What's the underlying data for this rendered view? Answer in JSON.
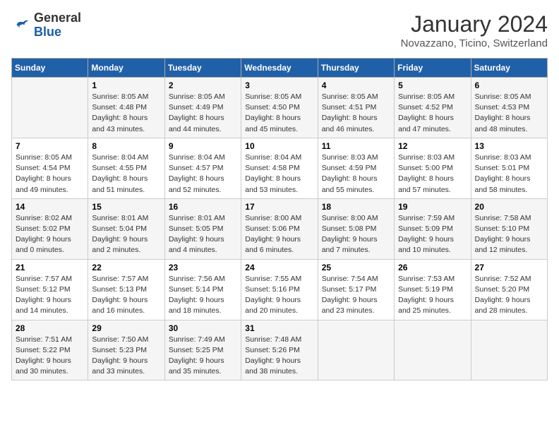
{
  "logo": {
    "general": "General",
    "blue": "Blue"
  },
  "header": {
    "month": "January 2024",
    "location": "Novazzano, Ticino, Switzerland"
  },
  "days_of_week": [
    "Sunday",
    "Monday",
    "Tuesday",
    "Wednesday",
    "Thursday",
    "Friday",
    "Saturday"
  ],
  "weeks": [
    [
      {
        "day": "",
        "info": ""
      },
      {
        "day": "1",
        "info": "Sunrise: 8:05 AM\nSunset: 4:48 PM\nDaylight: 8 hours\nand 43 minutes."
      },
      {
        "day": "2",
        "info": "Sunrise: 8:05 AM\nSunset: 4:49 PM\nDaylight: 8 hours\nand 44 minutes."
      },
      {
        "day": "3",
        "info": "Sunrise: 8:05 AM\nSunset: 4:50 PM\nDaylight: 8 hours\nand 45 minutes."
      },
      {
        "day": "4",
        "info": "Sunrise: 8:05 AM\nSunset: 4:51 PM\nDaylight: 8 hours\nand 46 minutes."
      },
      {
        "day": "5",
        "info": "Sunrise: 8:05 AM\nSunset: 4:52 PM\nDaylight: 8 hours\nand 47 minutes."
      },
      {
        "day": "6",
        "info": "Sunrise: 8:05 AM\nSunset: 4:53 PM\nDaylight: 8 hours\nand 48 minutes."
      }
    ],
    [
      {
        "day": "7",
        "info": "Sunrise: 8:05 AM\nSunset: 4:54 PM\nDaylight: 8 hours\nand 49 minutes."
      },
      {
        "day": "8",
        "info": "Sunrise: 8:04 AM\nSunset: 4:55 PM\nDaylight: 8 hours\nand 51 minutes."
      },
      {
        "day": "9",
        "info": "Sunrise: 8:04 AM\nSunset: 4:57 PM\nDaylight: 8 hours\nand 52 minutes."
      },
      {
        "day": "10",
        "info": "Sunrise: 8:04 AM\nSunset: 4:58 PM\nDaylight: 8 hours\nand 53 minutes."
      },
      {
        "day": "11",
        "info": "Sunrise: 8:03 AM\nSunset: 4:59 PM\nDaylight: 8 hours\nand 55 minutes."
      },
      {
        "day": "12",
        "info": "Sunrise: 8:03 AM\nSunset: 5:00 PM\nDaylight: 8 hours\nand 57 minutes."
      },
      {
        "day": "13",
        "info": "Sunrise: 8:03 AM\nSunset: 5:01 PM\nDaylight: 8 hours\nand 58 minutes."
      }
    ],
    [
      {
        "day": "14",
        "info": "Sunrise: 8:02 AM\nSunset: 5:02 PM\nDaylight: 9 hours\nand 0 minutes."
      },
      {
        "day": "15",
        "info": "Sunrise: 8:01 AM\nSunset: 5:04 PM\nDaylight: 9 hours\nand 2 minutes."
      },
      {
        "day": "16",
        "info": "Sunrise: 8:01 AM\nSunset: 5:05 PM\nDaylight: 9 hours\nand 4 minutes."
      },
      {
        "day": "17",
        "info": "Sunrise: 8:00 AM\nSunset: 5:06 PM\nDaylight: 9 hours\nand 6 minutes."
      },
      {
        "day": "18",
        "info": "Sunrise: 8:00 AM\nSunset: 5:08 PM\nDaylight: 9 hours\nand 7 minutes."
      },
      {
        "day": "19",
        "info": "Sunrise: 7:59 AM\nSunset: 5:09 PM\nDaylight: 9 hours\nand 10 minutes."
      },
      {
        "day": "20",
        "info": "Sunrise: 7:58 AM\nSunset: 5:10 PM\nDaylight: 9 hours\nand 12 minutes."
      }
    ],
    [
      {
        "day": "21",
        "info": "Sunrise: 7:57 AM\nSunset: 5:12 PM\nDaylight: 9 hours\nand 14 minutes."
      },
      {
        "day": "22",
        "info": "Sunrise: 7:57 AM\nSunset: 5:13 PM\nDaylight: 9 hours\nand 16 minutes."
      },
      {
        "day": "23",
        "info": "Sunrise: 7:56 AM\nSunset: 5:14 PM\nDaylight: 9 hours\nand 18 minutes."
      },
      {
        "day": "24",
        "info": "Sunrise: 7:55 AM\nSunset: 5:16 PM\nDaylight: 9 hours\nand 20 minutes."
      },
      {
        "day": "25",
        "info": "Sunrise: 7:54 AM\nSunset: 5:17 PM\nDaylight: 9 hours\nand 23 minutes."
      },
      {
        "day": "26",
        "info": "Sunrise: 7:53 AM\nSunset: 5:19 PM\nDaylight: 9 hours\nand 25 minutes."
      },
      {
        "day": "27",
        "info": "Sunrise: 7:52 AM\nSunset: 5:20 PM\nDaylight: 9 hours\nand 28 minutes."
      }
    ],
    [
      {
        "day": "28",
        "info": "Sunrise: 7:51 AM\nSunset: 5:22 PM\nDaylight: 9 hours\nand 30 minutes."
      },
      {
        "day": "29",
        "info": "Sunrise: 7:50 AM\nSunset: 5:23 PM\nDaylight: 9 hours\nand 33 minutes."
      },
      {
        "day": "30",
        "info": "Sunrise: 7:49 AM\nSunset: 5:25 PM\nDaylight: 9 hours\nand 35 minutes."
      },
      {
        "day": "31",
        "info": "Sunrise: 7:48 AM\nSunset: 5:26 PM\nDaylight: 9 hours\nand 38 minutes."
      },
      {
        "day": "",
        "info": ""
      },
      {
        "day": "",
        "info": ""
      },
      {
        "day": "",
        "info": ""
      }
    ]
  ]
}
